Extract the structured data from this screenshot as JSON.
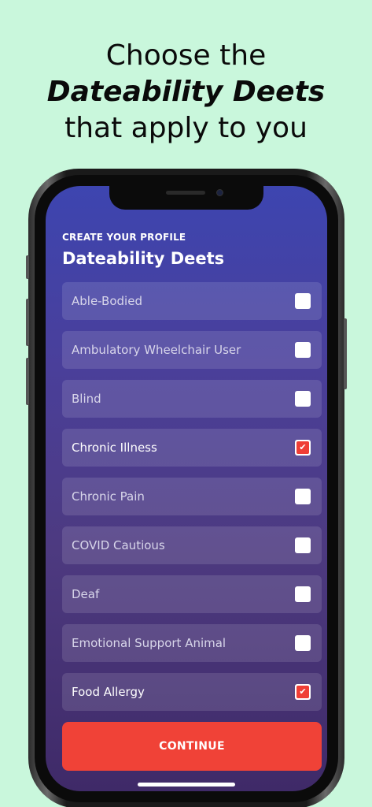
{
  "headline": {
    "line1": "Choose the",
    "line2": "Dateability Deets",
    "line3": "that apply to you"
  },
  "screen": {
    "subtitle": "CREATE YOUR PROFILE",
    "title": "Dateability Deets",
    "options": [
      {
        "label": "Able-Bodied",
        "checked": false
      },
      {
        "label": "Ambulatory Wheelchair User",
        "checked": false
      },
      {
        "label": "Blind",
        "checked": false
      },
      {
        "label": "Chronic Illness",
        "checked": true
      },
      {
        "label": "Chronic Pain",
        "checked": false
      },
      {
        "label": "COVID Cautious",
        "checked": false
      },
      {
        "label": "Deaf",
        "checked": false
      },
      {
        "label": "Emotional Support Animal",
        "checked": false
      },
      {
        "label": "Food Allergy",
        "checked": true
      }
    ],
    "continue_label": "CONTINUE"
  },
  "colors": {
    "background": "#c9f7dc",
    "accent": "#f04237",
    "screen_top": "#3d45b0",
    "screen_bottom": "#3f2a68"
  },
  "icons": {
    "checkbox_checked": "check-icon"
  }
}
